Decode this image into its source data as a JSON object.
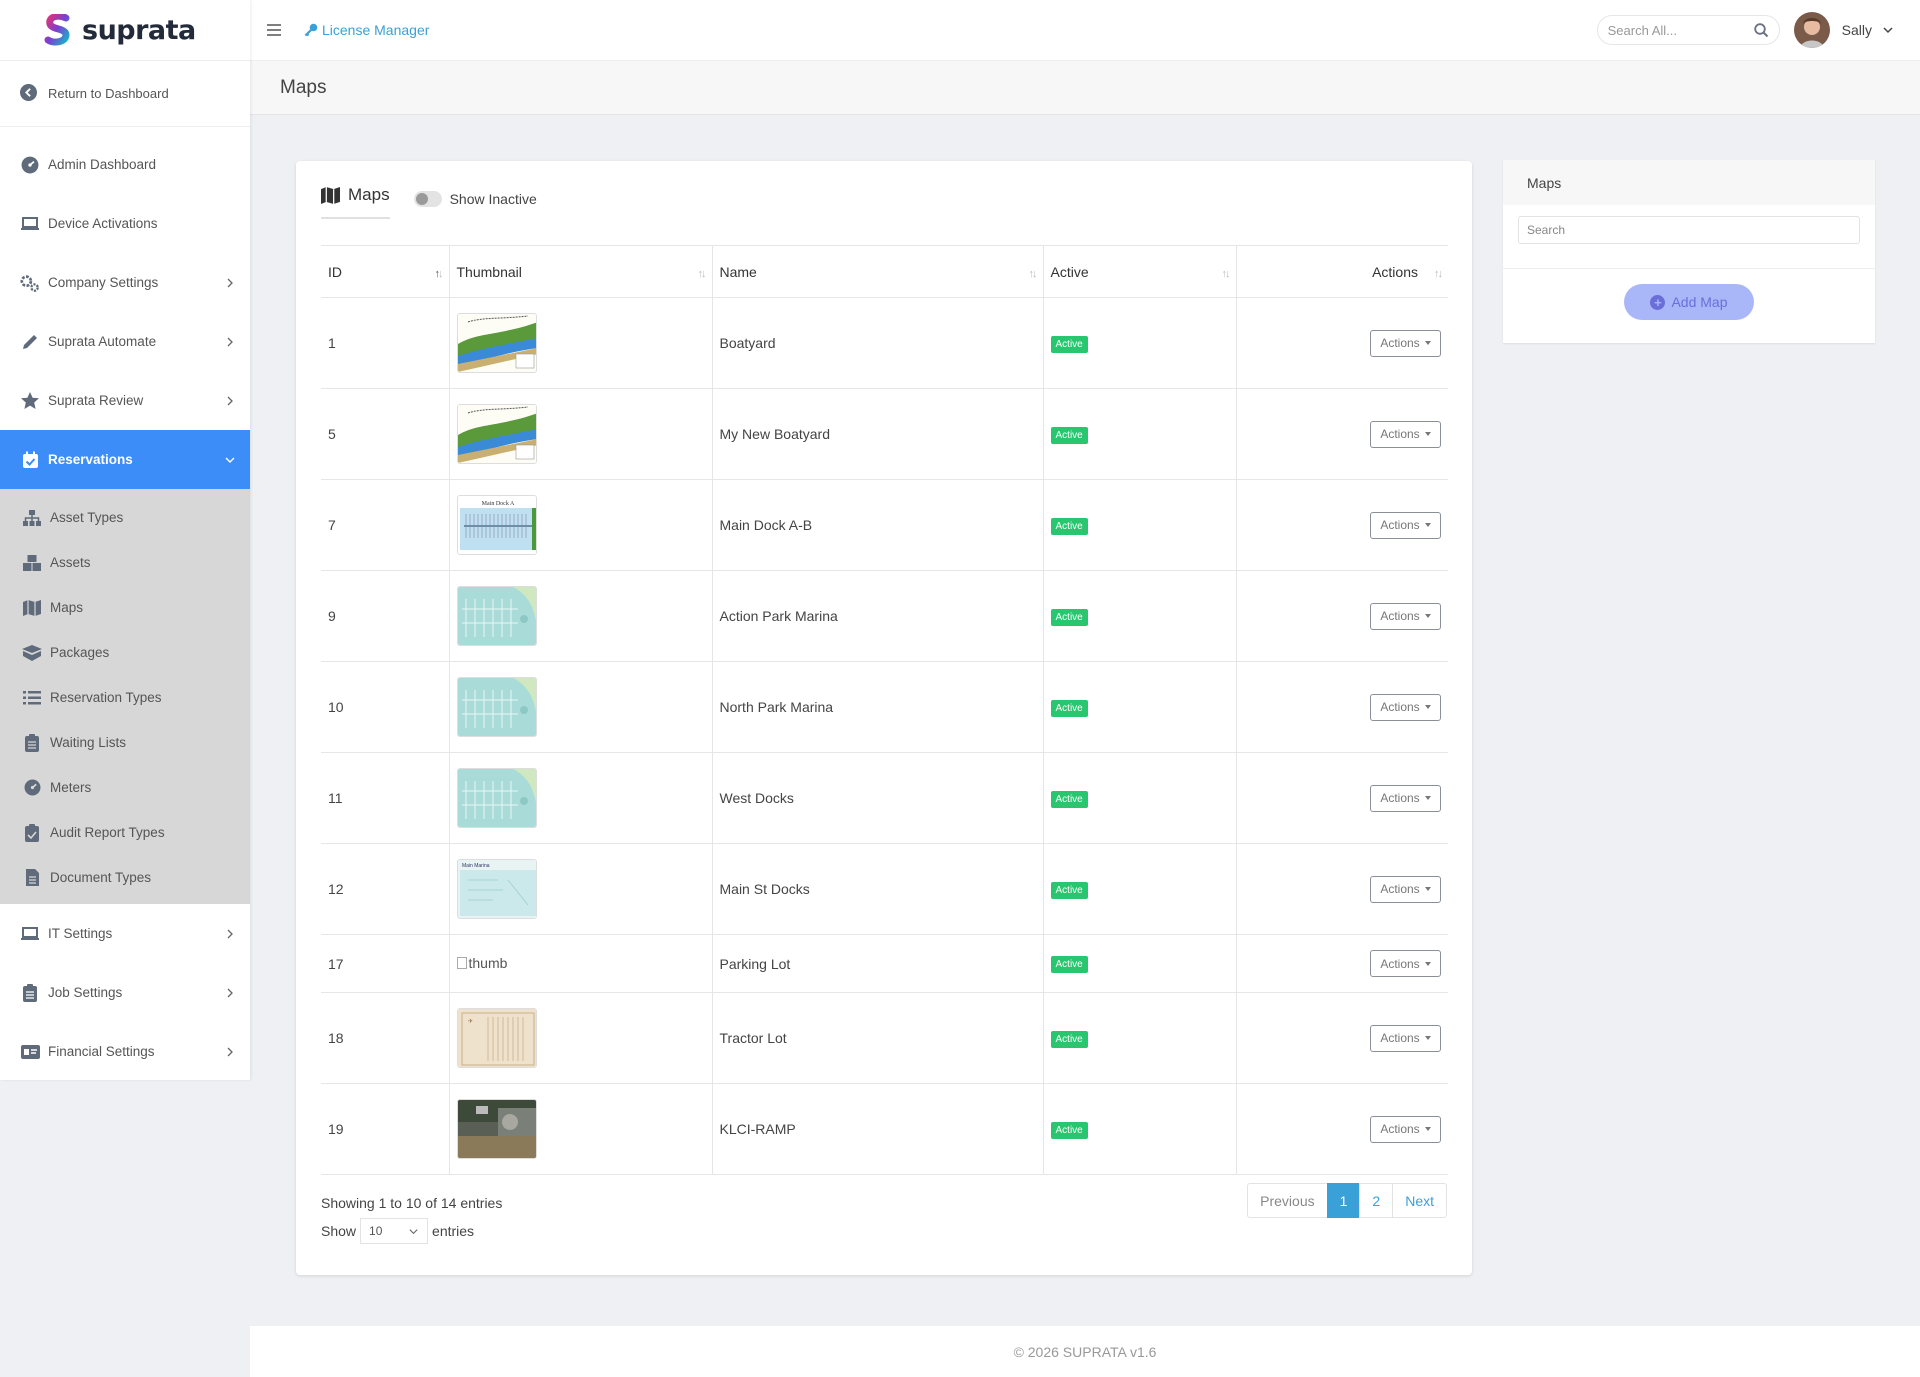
{
  "brand": {
    "name": "suprata"
  },
  "sidebar": {
    "return": "Return to Dashboard",
    "items": [
      {
        "label": "Admin Dashboard",
        "icon": "dashboard-icon",
        "chevron": false
      },
      {
        "label": "Device Activations",
        "icon": "laptop-icon",
        "chevron": false
      },
      {
        "label": "Company Settings",
        "icon": "gears-icon",
        "chevron": true
      },
      {
        "label": "Suprata Automate",
        "icon": "pencil-icon",
        "chevron": true
      },
      {
        "label": "Suprata Review",
        "icon": "star-icon",
        "chevron": true
      }
    ],
    "active": {
      "label": "Reservations",
      "icon": "calendar-check-icon"
    },
    "sub_items": [
      {
        "label": "Asset Types",
        "icon": "sitemap-icon"
      },
      {
        "label": "Assets",
        "icon": "boxes-icon"
      },
      {
        "label": "Maps",
        "icon": "map-icon"
      },
      {
        "label": "Packages",
        "icon": "box-icon"
      },
      {
        "label": "Reservation Types",
        "icon": "list-icon"
      },
      {
        "label": "Waiting Lists",
        "icon": "clipboard-list-icon"
      },
      {
        "label": "Meters",
        "icon": "gauge-icon"
      },
      {
        "label": "Audit Report Types",
        "icon": "clipboard-check-icon"
      },
      {
        "label": "Document Types",
        "icon": "file-icon"
      }
    ],
    "bottom_items": [
      {
        "label": "IT Settings",
        "icon": "laptop-icon",
        "chevron": true
      },
      {
        "label": "Job Settings",
        "icon": "clipboard-icon",
        "chevron": true
      },
      {
        "label": "Financial Settings",
        "icon": "money-icon",
        "chevron": true
      }
    ]
  },
  "topbar": {
    "breadcrumb": "License Manager",
    "search_placeholder": "Search All...",
    "user": "Sally"
  },
  "page": {
    "title": "Maps"
  },
  "card": {
    "tab": "Maps",
    "toggle_label": "Show Inactive"
  },
  "table": {
    "headers": [
      "ID",
      "Thumbnail",
      "Name",
      "Active",
      "Actions"
    ],
    "rows": [
      {
        "id": "1",
        "name": "Boatyard",
        "thumb": "boatyard",
        "status": "Active",
        "action": "Actions"
      },
      {
        "id": "5",
        "name": "My New Boatyard",
        "thumb": "boatyard",
        "status": "Active",
        "action": "Actions"
      },
      {
        "id": "7",
        "name": "Main Dock A-B",
        "thumb": "dock",
        "status": "Active",
        "action": "Actions"
      },
      {
        "id": "9",
        "name": "Action Park Marina",
        "thumb": "marina",
        "status": "Active",
        "action": "Actions"
      },
      {
        "id": "10",
        "name": "North Park Marina",
        "thumb": "marina",
        "status": "Active",
        "action": "Actions"
      },
      {
        "id": "11",
        "name": "West Docks",
        "thumb": "marina",
        "status": "Active",
        "action": "Actions"
      },
      {
        "id": "12",
        "name": "Main St Docks",
        "thumb": "mainst",
        "status": "Active",
        "action": "Actions"
      },
      {
        "id": "17",
        "name": "Parking Lot",
        "thumb": "broken",
        "thumb_alt": "thumb",
        "status": "Active",
        "action": "Actions"
      },
      {
        "id": "18",
        "name": "Tractor Lot",
        "thumb": "tractor",
        "status": "Active",
        "action": "Actions"
      },
      {
        "id": "19",
        "name": "KLCI-RAMP",
        "thumb": "aerial",
        "status": "Active",
        "action": "Actions"
      }
    ]
  },
  "footer_info": {
    "showing": "Showing 1 to 10 of 14 entries",
    "show": "Show",
    "length": "10",
    "entries": "entries",
    "pagination": {
      "prev": "Previous",
      "pages": [
        "1",
        "2"
      ],
      "next": "Next"
    }
  },
  "right_panel": {
    "title": "Maps",
    "search_placeholder": "Search",
    "add_button": "Add Map"
  },
  "footer": "© 2026 SUPRATA v1.6",
  "colors": {
    "accent": "#3c8df7",
    "link": "#3aa0d8",
    "active_badge": "#28c76f",
    "add_button": "#a9b7f8"
  }
}
